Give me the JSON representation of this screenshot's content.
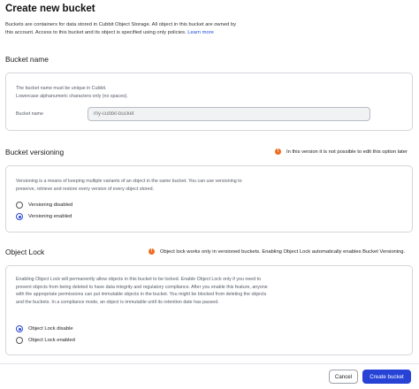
{
  "page": {
    "title": "Create new bucket",
    "description": "Buckets are containers for data stored in Cubbit Object Storage. All object in this bucket are owned by this account. Access to this bucket and its object is specified using only policies.",
    "learn_more": "Learn more"
  },
  "bucket_name": {
    "section_title": "Bucket name",
    "help_line1": "The bucket name must be unique in Cubbit.",
    "help_line2": "Lowercase alphanumeric characters only (no spaces).",
    "field_label": "Bucket name",
    "placeholder": "my-cubbit-bucket"
  },
  "versioning": {
    "section_title": "Bucket versioning",
    "notice": "In this version it is not possible to edit this option later",
    "description": "Versioning is a means of keeping multiple variants of an object in the same bucket. You can use versioning to preserve, retrieve and restore every version of every object stored.",
    "options": [
      {
        "label": "Versioning disabled",
        "selected": false
      },
      {
        "label": "Versioning enabled",
        "selected": true
      }
    ]
  },
  "object_lock": {
    "section_title": "Object Lock",
    "notice": "Object lock works only in versioned buckets. Enabling Object Lock automatically enables Bucket Versioning.",
    "description": "Enabling Object Lock will permanently allow objects in this bucket to be locked. Enable Object Lock only if you need to prevent objects from being deleted to have data integrity and regulatory compliance. After you enable this feature, anyone with the appropriate permissions can put immutable objects in the bucket. You might be blocked from deleting the objects and the buckets. In a compliance mode, an object is immutable until its retention date has passed.",
    "options": [
      {
        "label": "Object Lock disable",
        "selected": true
      },
      {
        "label": "Object Lock enabled",
        "selected": false
      }
    ]
  },
  "footer": {
    "cancel_label": "Cancel",
    "create_label": "Create bucket"
  },
  "colors": {
    "accent": "#2643d6",
    "warning": "#ef6b1f",
    "link": "#1f4fd8"
  },
  "icons": {
    "notice": "warning-icon"
  }
}
